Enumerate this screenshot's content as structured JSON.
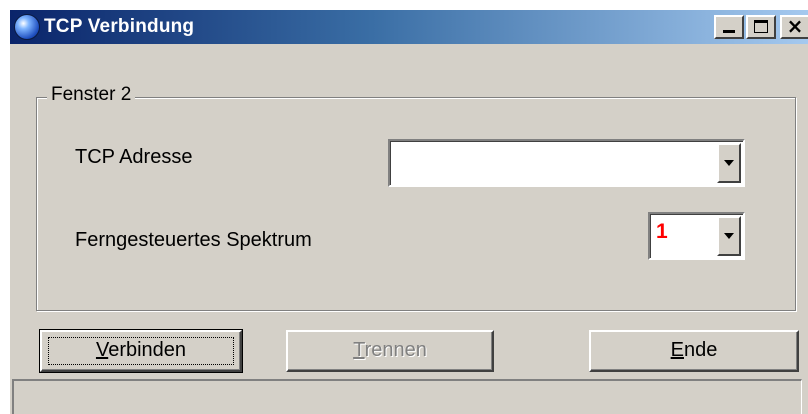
{
  "window": {
    "title": "TCP Verbindung",
    "icon": "globe-icon"
  },
  "caption_buttons": {
    "minimize": "minimize-icon",
    "maximize": "maximize-icon",
    "close": "×"
  },
  "group": {
    "legend": "Fenster 2",
    "tcp_address_label": "TCP Adresse",
    "tcp_address_value": "",
    "spectrum_label": "Ferngesteuertes Spektrum",
    "spectrum_value": "1"
  },
  "buttons": {
    "connect": {
      "mnemonic": "V",
      "rest": "erbinden"
    },
    "disconnect": {
      "mnemonic": "T",
      "rest": "rennen"
    },
    "end": {
      "mnemonic": "E",
      "rest": "nde"
    }
  },
  "statusbar": {
    "text": ""
  },
  "colors": {
    "face": "#d4d0c8",
    "title_start": "#0a246a",
    "title_end": "#a6caf0",
    "spectrum_value": "#ff0000",
    "disabled_text": "#808080"
  }
}
